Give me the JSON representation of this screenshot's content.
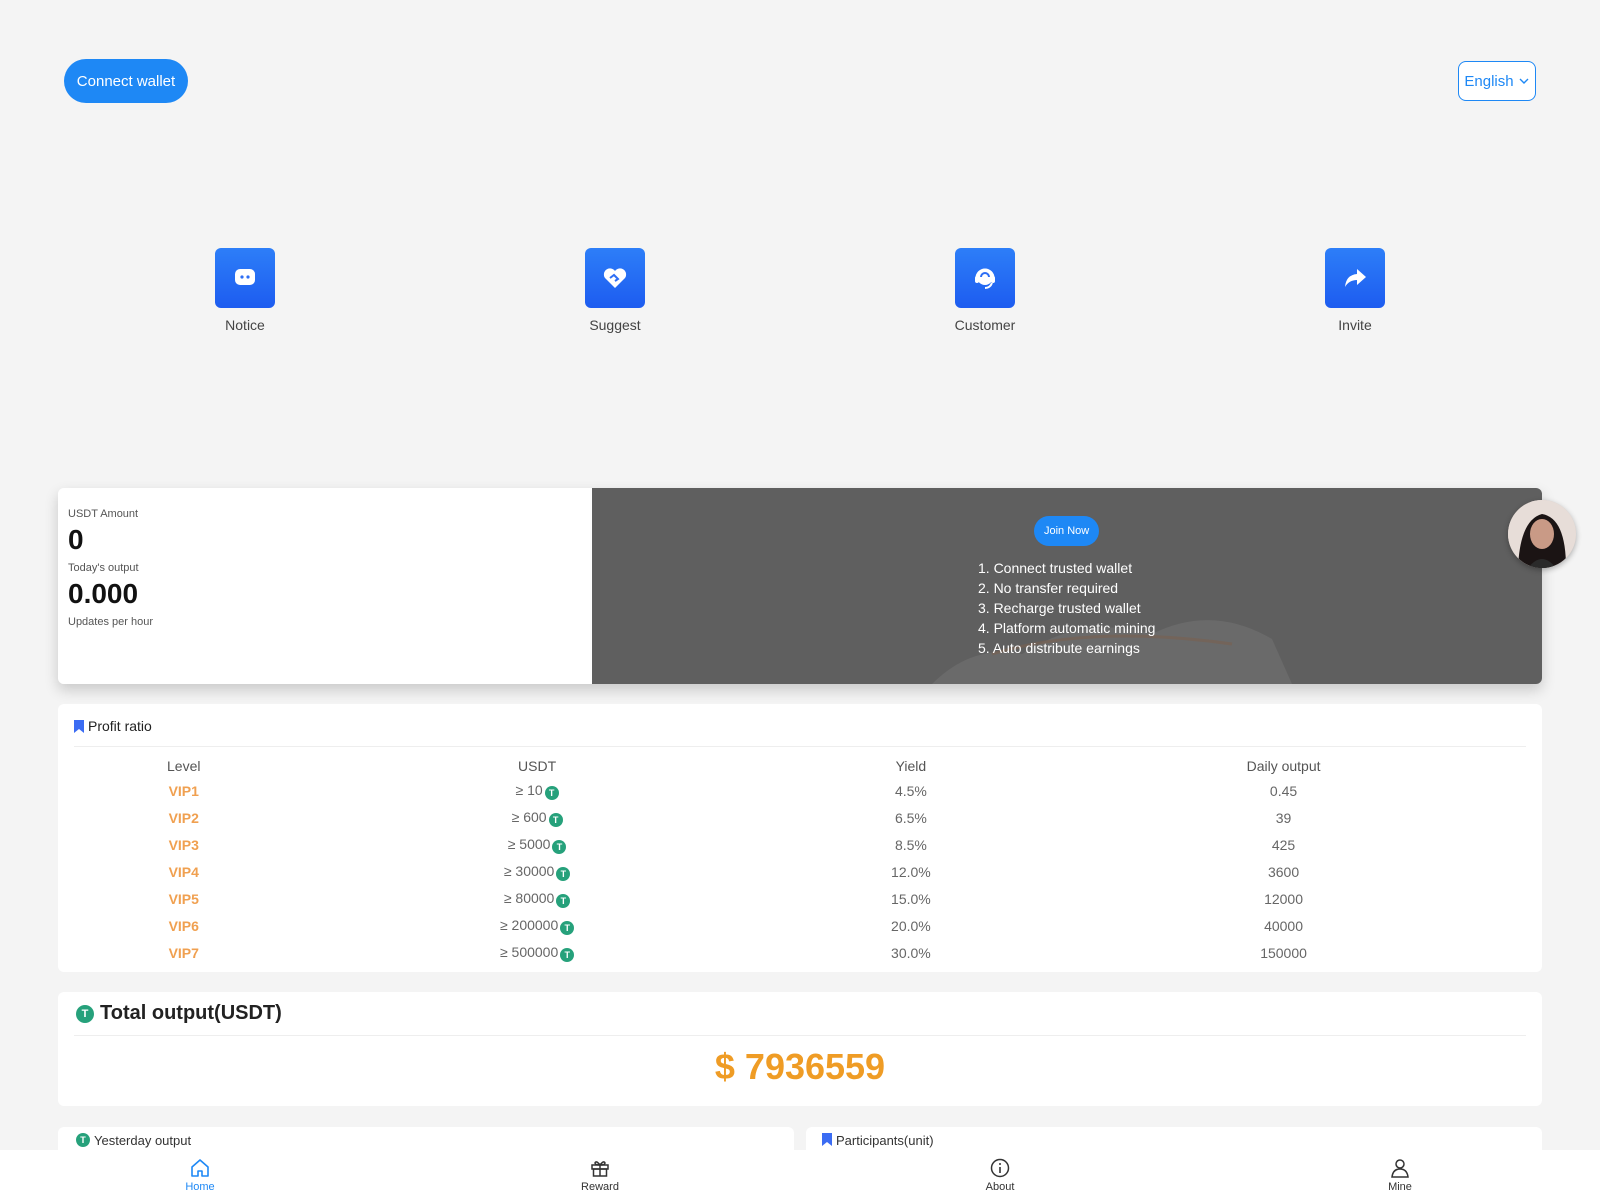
{
  "header": {
    "connect_label": "Connect wallet",
    "language": "English"
  },
  "quick_actions": [
    {
      "label": "Notice",
      "icon": "chat-icon"
    },
    {
      "label": "Suggest",
      "icon": "heart-handshake-icon"
    },
    {
      "label": "Customer",
      "icon": "headset-icon"
    },
    {
      "label": "Invite",
      "icon": "share-arrow-icon"
    }
  ],
  "banner": {
    "usdt_amount_label": "USDT Amount",
    "usdt_amount_value": "0",
    "todays_output_label": "Today's output",
    "todays_output_value": "0.000",
    "updates_note": "Updates per hour",
    "join_label": "Join Now",
    "steps": [
      "1. Connect trusted wallet",
      "2. No transfer required",
      "3. Recharge trusted wallet",
      "4. Platform automatic mining",
      "5. Auto distribute earnings"
    ]
  },
  "profit": {
    "title": "Profit ratio",
    "columns": [
      "Level",
      "USDT",
      "Yield",
      "Daily output"
    ],
    "rows": [
      {
        "level": "VIP1",
        "usdt": "≥ 10",
        "yield": "4.5%",
        "daily": "0.45"
      },
      {
        "level": "VIP2",
        "usdt": "≥ 600",
        "yield": "6.5%",
        "daily": "39"
      },
      {
        "level": "VIP3",
        "usdt": "≥ 5000",
        "yield": "8.5%",
        "daily": "425"
      },
      {
        "level": "VIP4",
        "usdt": "≥ 30000",
        "yield": "12.0%",
        "daily": "3600"
      },
      {
        "level": "VIP5",
        "usdt": "≥ 80000",
        "yield": "15.0%",
        "daily": "12000"
      },
      {
        "level": "VIP6",
        "usdt": "≥ 200000",
        "yield": "20.0%",
        "daily": "40000"
      },
      {
        "level": "VIP7",
        "usdt": "≥ 500000",
        "yield": "30.0%",
        "daily": "150000"
      }
    ]
  },
  "total": {
    "title": "Total output(USDT)",
    "value": "$ 7936559"
  },
  "cards": {
    "yesterday": "Yesterday output",
    "participants": "Participants(unit)"
  },
  "tether_symbol": "T",
  "tabbar": [
    {
      "label": "Home",
      "icon": "home-icon",
      "active": true
    },
    {
      "label": "Reward",
      "icon": "gift-icon",
      "active": false
    },
    {
      "label": "About",
      "icon": "info-icon",
      "active": false
    },
    {
      "label": "Mine",
      "icon": "user-icon",
      "active": false
    }
  ],
  "colors": {
    "accent": "#1e88f5",
    "vip": "#f0a050",
    "total": "#ef9c25",
    "tether": "#26a17b",
    "banner_bg": "#5f5f5f"
  }
}
